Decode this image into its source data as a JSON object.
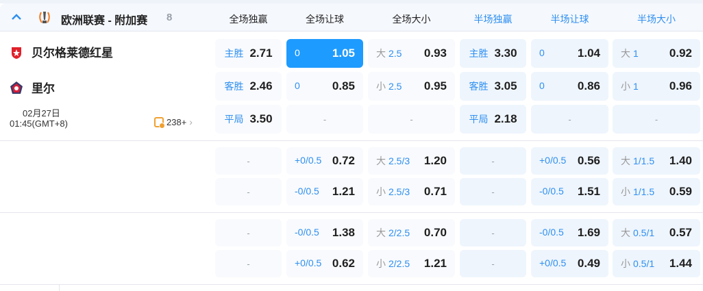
{
  "league": {
    "name": "欧洲联赛 - 附加赛",
    "count": "8",
    "icon": "europa-league-trophy-icon",
    "collapse_icon": "chevron-up-icon"
  },
  "columns": [
    "全场独赢",
    "全场让球",
    "全场大小",
    "半场独赢",
    "半场让球",
    "半场大小"
  ],
  "match": {
    "home": "贝尔格莱德红星",
    "away": "里尔",
    "date": "02月27日",
    "time": "01:45(GMT+8)",
    "bets": "238+"
  },
  "colors": {
    "accent": "#2e8ff0",
    "selected": "#1e9bff"
  },
  "blocks": [
    {
      "rows": [
        [
          {
            "t": "win",
            "label": "主胜",
            "value": "2.71"
          },
          {
            "t": "line",
            "label": "0",
            "value": "1.05",
            "selected": true
          },
          {
            "t": "ou",
            "pre": "大",
            "label": "2.5",
            "value": "0.93"
          },
          {
            "t": "win",
            "label": "主胜",
            "value": "3.30"
          },
          {
            "t": "line",
            "label": "0",
            "value": "1.04"
          },
          {
            "t": "ou",
            "pre": "大",
            "label": "1",
            "value": "0.92"
          }
        ],
        [
          {
            "t": "win",
            "label": "客胜",
            "value": "2.46"
          },
          {
            "t": "line",
            "label": "0",
            "value": "0.85"
          },
          {
            "t": "ou",
            "pre": "小",
            "label": "2.5",
            "value": "0.95"
          },
          {
            "t": "win",
            "label": "客胜",
            "value": "3.05"
          },
          {
            "t": "line",
            "label": "0",
            "value": "0.86"
          },
          {
            "t": "ou",
            "pre": "小",
            "label": "1",
            "value": "0.96"
          }
        ],
        [
          {
            "t": "win",
            "label": "平局",
            "value": "3.50"
          },
          {
            "t": "empty",
            "value": "-"
          },
          {
            "t": "empty",
            "value": "-"
          },
          {
            "t": "win",
            "label": "平局",
            "value": "2.18"
          },
          {
            "t": "empty",
            "value": "-"
          },
          {
            "t": "empty",
            "value": "-"
          }
        ]
      ]
    },
    {
      "rows": [
        [
          {
            "t": "empty",
            "value": "-"
          },
          {
            "t": "line",
            "label": "+0/0.5",
            "value": "0.72"
          },
          {
            "t": "ou",
            "pre": "大",
            "label": "2.5/3",
            "value": "1.20"
          },
          {
            "t": "empty",
            "value": "-"
          },
          {
            "t": "line",
            "label": "+0/0.5",
            "value": "0.56"
          },
          {
            "t": "ou",
            "pre": "大",
            "label": "1/1.5",
            "value": "1.40"
          }
        ],
        [
          {
            "t": "empty",
            "value": "-"
          },
          {
            "t": "line",
            "label": "-0/0.5",
            "value": "1.21"
          },
          {
            "t": "ou",
            "pre": "小",
            "label": "2.5/3",
            "value": "0.71"
          },
          {
            "t": "empty",
            "value": "-"
          },
          {
            "t": "line",
            "label": "-0/0.5",
            "value": "1.51"
          },
          {
            "t": "ou",
            "pre": "小",
            "label": "1/1.5",
            "value": "0.59"
          }
        ]
      ]
    },
    {
      "rows": [
        [
          {
            "t": "empty",
            "value": "-"
          },
          {
            "t": "line",
            "label": "-0/0.5",
            "value": "1.38"
          },
          {
            "t": "ou",
            "pre": "大",
            "label": "2/2.5",
            "value": "0.70"
          },
          {
            "t": "empty",
            "value": "-"
          },
          {
            "t": "line",
            "label": "-0/0.5",
            "value": "1.69"
          },
          {
            "t": "ou",
            "pre": "大",
            "label": "0.5/1",
            "value": "0.57"
          }
        ],
        [
          {
            "t": "empty",
            "value": "-"
          },
          {
            "t": "line",
            "label": "+0/0.5",
            "value": "0.62"
          },
          {
            "t": "ou",
            "pre": "小",
            "label": "2/2.5",
            "value": "1.21"
          },
          {
            "t": "empty",
            "value": "-"
          },
          {
            "t": "line",
            "label": "+0/0.5",
            "value": "0.49"
          },
          {
            "t": "ou",
            "pre": "小",
            "label": "0.5/1",
            "value": "1.44"
          }
        ]
      ]
    }
  ]
}
